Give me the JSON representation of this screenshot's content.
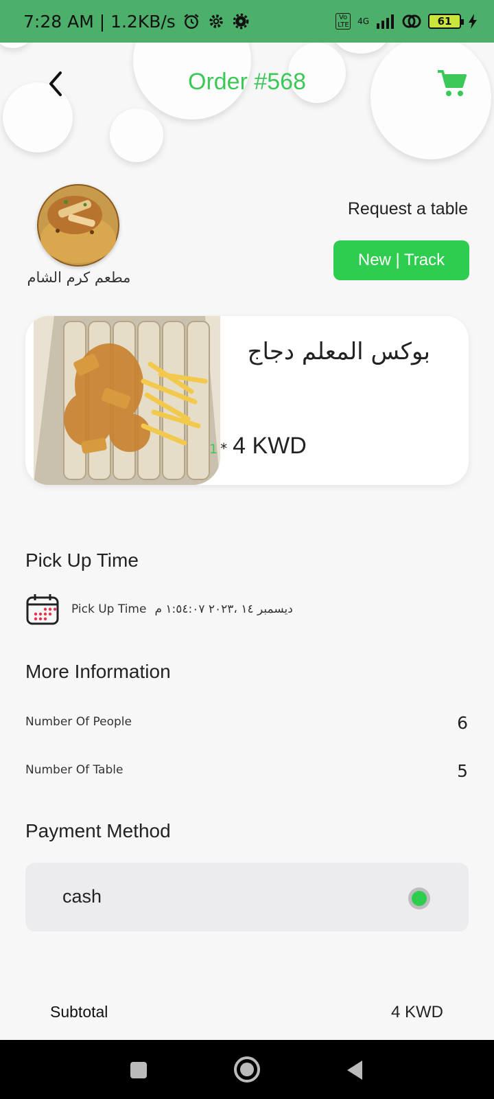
{
  "status_bar": {
    "time_speed": "7:28 AM | 1.2KB/s",
    "network": "4G",
    "volte": "Vo LTE",
    "battery": "61"
  },
  "header": {
    "title": "Order #568"
  },
  "restaurant": {
    "name": "مطعم كرم الشام"
  },
  "table": {
    "request_label": "Request a table",
    "track_button": "New | Track"
  },
  "order_item": {
    "name": "بوكس المعلم دجاج",
    "quantity": "1",
    "multiplier": "*",
    "price": "4 KWD"
  },
  "pickup": {
    "section_title": "Pick Up Time",
    "label": "Pick Up Time",
    "value": "ديسمبر ١٤ ،٢٠٢٣ ١:٥٤:٠٧ م"
  },
  "more_info": {
    "section_title": "More Information",
    "people_label": "Number Of People",
    "people_value": "6",
    "table_label": "Number Of Table",
    "table_value": "5"
  },
  "payment": {
    "section_title": "Payment Method",
    "method": "cash"
  },
  "summary": {
    "subtotal_label": "Subtotal",
    "subtotal_value": "4 KWD"
  },
  "colors": {
    "accent": "#2ecc4f",
    "title": "#3cc858",
    "status_bar": "#4caf6a"
  }
}
